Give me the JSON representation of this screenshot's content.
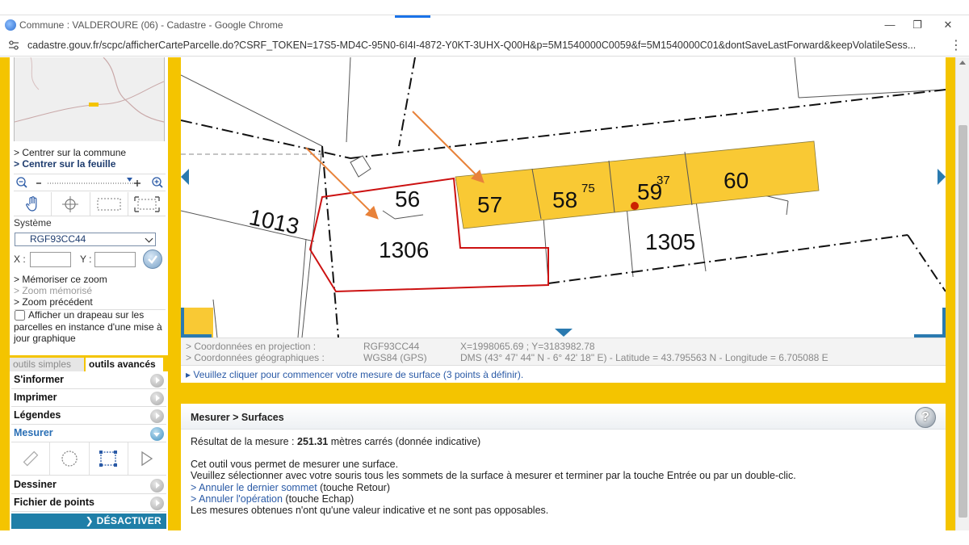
{
  "window": {
    "title": "Commune : VALDEROURE (06) - Cadastre - Google Chrome",
    "url": "cadastre.gouv.fr/scpc/afficherCarteParcelle.do?CSRF_TOKEN=17S5-MD4C-95N0-6I4I-4872-Y0KT-3UHX-Q00H&p=5M1540000C0059&f=5M1540000C01&dontSaveLastForward&keepVolatileSess..."
  },
  "left_panel": {
    "links": {
      "center_commune": "> Centrer sur la commune",
      "center_feuille": "> Centrer sur la feuille",
      "memorize_zoom": "> Mémoriser ce zoom",
      "zoom_memorise": "> Zoom mémorisé",
      "zoom_precedent": "> Zoom précédent"
    },
    "systeme_label": "Système",
    "systeme_value": "RGF93CC44",
    "x_label": "X :",
    "y_label": "Y :",
    "flag_label": "Afficher un drapeau sur les parcelles en instance d'une mise à jour graphique",
    "tabs": {
      "simple": "outils simples",
      "advanced": "outils avancés"
    },
    "menu": {
      "informer": "S'informer",
      "imprimer": "Imprimer",
      "legendes": "Légendes",
      "mesurer": "Mesurer",
      "dessiner": "Dessiner",
      "fichier": "Fichier de points"
    },
    "deactivate": "DÉSACTIVER"
  },
  "map": {
    "parcels": {
      "p56": "56",
      "p57": "57",
      "p58": "58",
      "p58_sup": "75",
      "p59": "59",
      "p59_sup": "37",
      "p60": "60",
      "p1013": "1013",
      "p1306": "1306",
      "p1305": "1305"
    },
    "colors": {
      "highlight": "#f9c934",
      "selection": "#cc1111",
      "arrow": "#e8823a",
      "nav": "#2a7ab0"
    }
  },
  "info": {
    "proj_label": "> Coordonnées en projection :",
    "proj_system": "RGF93CC44",
    "proj_values": "X=1998065.69 ; Y=3183982.78",
    "geo_label": "> Coordonnées géographiques :",
    "geo_system": "WGS84 (GPS)",
    "geo_values": "DMS (43° 47' 44\" N - 6° 42' 18\" E) - Latitude = 43.795563 N - Longitude = 6.705088 E",
    "hint": "Veuillez cliquer pour commencer votre mesure de surface (3 points à définir)."
  },
  "measure": {
    "title": "Mesurer > Surfaces",
    "result_prefix": "Résultat de la mesure : ",
    "result_value": "251.31",
    "result_suffix": " mètres carrés (donnée indicative)",
    "line1": "Cet outil vous permet de mesurer une surface.",
    "line2": "Veuillez sélectionner avec votre souris tous les sommets de la surface à mesurer et terminer par la touche Entrée ou par un double-clic.",
    "undo_link": "> Annuler le dernier sommet",
    "undo_key": " (touche Retour)",
    "cancel_link": "> Annuler l'opération",
    "cancel_key": " (touche Echap)",
    "line5": "Les mesures obtenues n'ont qu'une valeur indicative et ne sont pas opposables.",
    "help": "?"
  }
}
